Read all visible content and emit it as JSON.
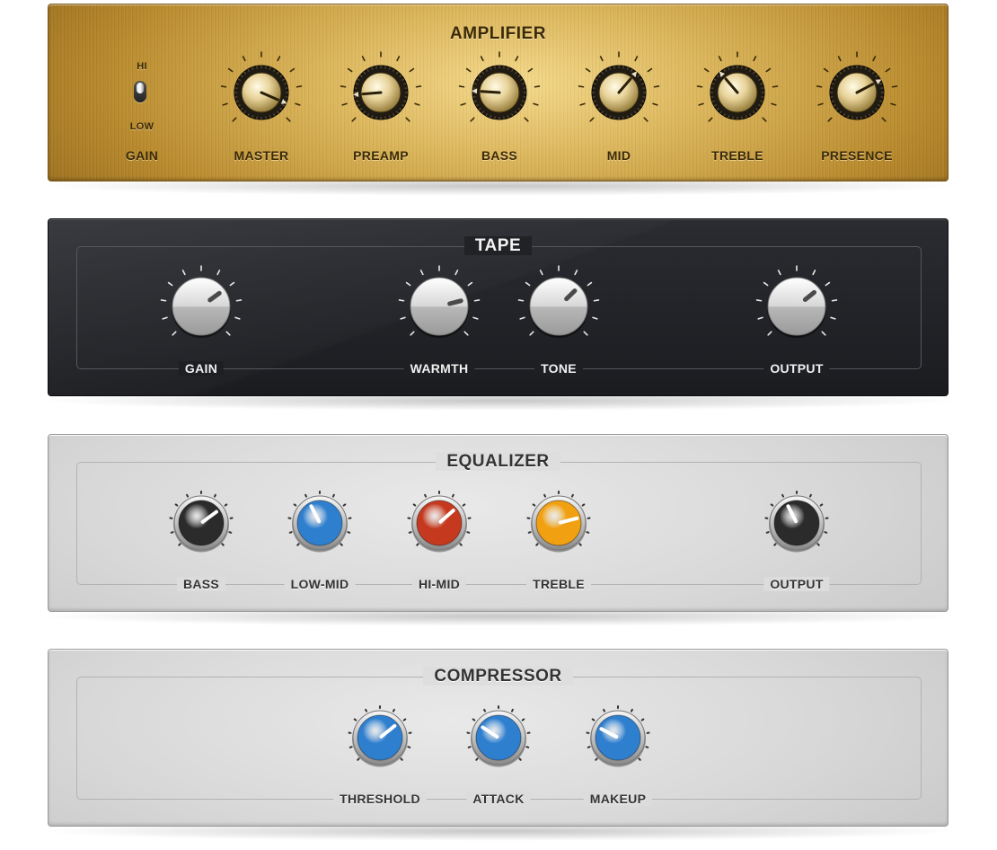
{
  "amplifier": {
    "title": "AMPLIFIER",
    "gain_switch": {
      "hi_label": "HI",
      "low_label": "LOW",
      "label": "GAIN",
      "state": "HI"
    },
    "knobs": [
      {
        "id": "master",
        "label": "MASTER",
        "value": 0.92
      },
      {
        "id": "preamp",
        "label": "PREAMP",
        "value": 0.15
      },
      {
        "id": "bass",
        "label": "BASS",
        "value": 0.18
      },
      {
        "id": "mid",
        "label": "MID",
        "value": 0.65
      },
      {
        "id": "treble",
        "label": "TREBLE",
        "value": 0.35
      },
      {
        "id": "presence",
        "label": "PRESENCE",
        "value": 0.73
      }
    ]
  },
  "tape": {
    "title": "TAPE",
    "knobs": [
      {
        "id": "gain",
        "label": "GAIN",
        "value": 0.7
      },
      {
        "id": "warmth",
        "label": "WARMTH",
        "value": 0.78
      },
      {
        "id": "tone",
        "label": "TONE",
        "value": 0.67
      },
      {
        "id": "output",
        "label": "OUTPUT",
        "value": 0.69
      }
    ]
  },
  "equalizer": {
    "title": "EQUALIZER",
    "knobs": [
      {
        "id": "bass",
        "label": "BASS",
        "value": 0.7,
        "color": "#2b2b2b"
      },
      {
        "id": "low_mid",
        "label": "LOW-MID",
        "value": 0.4,
        "color": "#2f7fcf"
      },
      {
        "id": "hi_mid",
        "label": "HI-MID",
        "value": 0.68,
        "color": "#c53a1f"
      },
      {
        "id": "treble",
        "label": "TREBLE",
        "value": 0.78,
        "color": "#f0a010"
      },
      {
        "id": "output",
        "label": "OUTPUT",
        "value": 0.4,
        "color": "#2b2b2b"
      }
    ]
  },
  "compressor": {
    "title": "COMPRESSOR",
    "knobs": [
      {
        "id": "threshold",
        "label": "THRESHOLD",
        "value": 0.69,
        "color": "#2f7fcf"
      },
      {
        "id": "attack",
        "label": "ATTACK",
        "value": 0.29,
        "color": "#2f7fcf"
      },
      {
        "id": "makeup",
        "label": "MAKEUP",
        "value": 0.27,
        "color": "#2f7fcf"
      }
    ]
  },
  "colors": {
    "gold": "#d9b257",
    "tape_bg": "#1f2024",
    "silver_bg": "#dcdcdc",
    "indicator": "#ffffff"
  }
}
